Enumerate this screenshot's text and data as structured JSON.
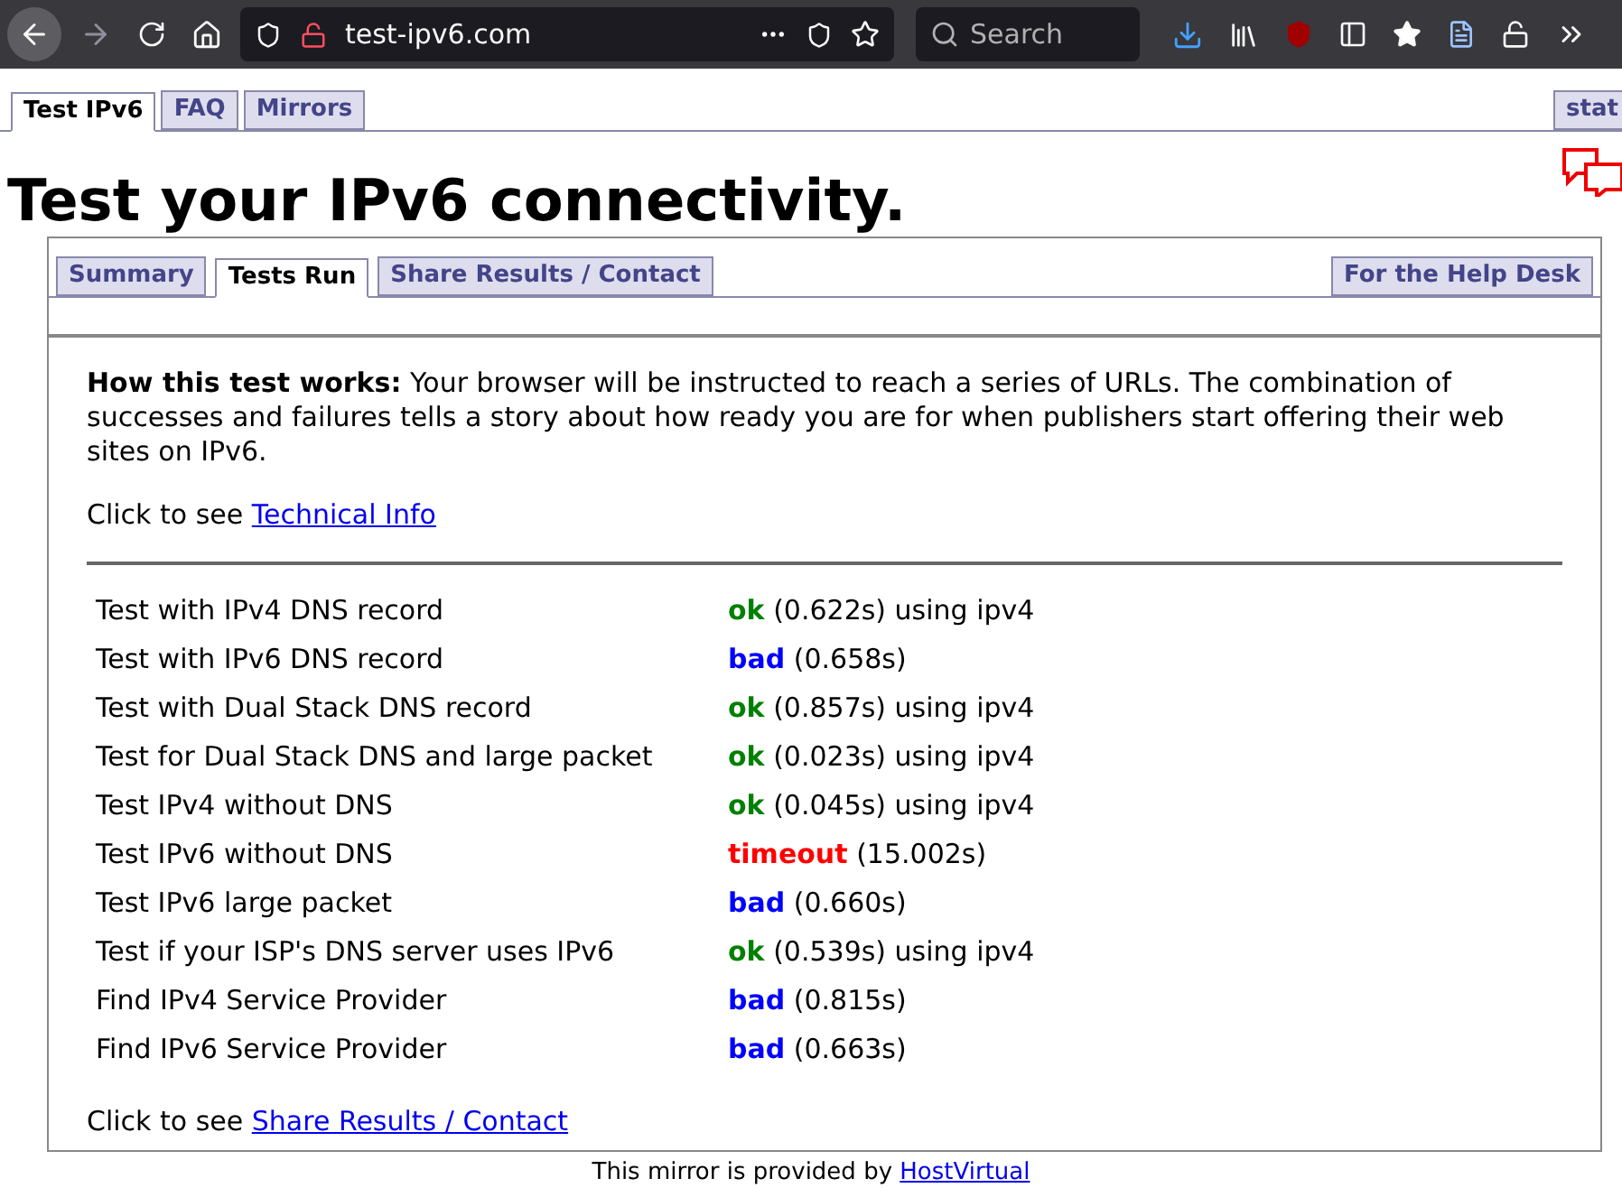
{
  "browser": {
    "url": "test-ipv6.com",
    "search_placeholder": "Search"
  },
  "site_tabs": [
    {
      "label": "Test IPv6",
      "selected": true
    },
    {
      "label": "FAQ",
      "selected": false
    },
    {
      "label": "Mirrors",
      "selected": false
    }
  ],
  "site_tab_right": "stat",
  "heading": "Test your IPv6 connectivity.",
  "panel_tabs": [
    {
      "label": "Summary",
      "selected": false
    },
    {
      "label": "Tests Run",
      "selected": true
    },
    {
      "label": "Share Results / Contact",
      "selected": false
    }
  ],
  "panel_tab_right": "For the Help Desk",
  "intro": "**How this test works:** Your browser will be instructed to reach a series of URLs. The combination of successes and failures tells a story about how ready you are for when publishers start offering their web sites on IPv6.",
  "tech_prompt": "Click to see",
  "tech_link": "Technical Info",
  "results": [
    {
      "test": "Test with IPv4 DNS record",
      "status": "ok",
      "kind": "ok",
      "detail": "(0.622s) using ipv4"
    },
    {
      "test": "Test with IPv6 DNS record",
      "status": "bad",
      "kind": "bad",
      "detail": "(0.658s)"
    },
    {
      "test": "Test with Dual Stack DNS record",
      "status": "ok",
      "kind": "ok",
      "detail": "(0.857s) using ipv4"
    },
    {
      "test": "Test for Dual Stack DNS and large packet",
      "status": "ok",
      "kind": "ok",
      "detail": "(0.023s) using ipv4"
    },
    {
      "test": "Test IPv4 without DNS",
      "status": "ok",
      "kind": "ok",
      "detail": "(0.045s) using ipv4"
    },
    {
      "test": "Test IPv6 without DNS",
      "status": "timeout",
      "kind": "timeout",
      "detail": "(15.002s)"
    },
    {
      "test": "Test IPv6 large packet",
      "status": "bad",
      "kind": "bad",
      "detail": "(0.660s)"
    },
    {
      "test": "Test if your ISP's DNS server uses IPv6",
      "status": "ok",
      "kind": "ok",
      "detail": "(0.539s) using ipv4"
    },
    {
      "test": "Find IPv4 Service Provider",
      "status": "bad",
      "kind": "bad",
      "detail": "(0.815s)"
    },
    {
      "test": "Find IPv6 Service Provider",
      "status": "bad",
      "kind": "bad",
      "detail": "(0.663s)"
    }
  ],
  "share_prompt": "Click to see",
  "share_link": "Share Results / Contact",
  "footer_text": "This mirror is provided by",
  "footer_link": "HostVirtual"
}
